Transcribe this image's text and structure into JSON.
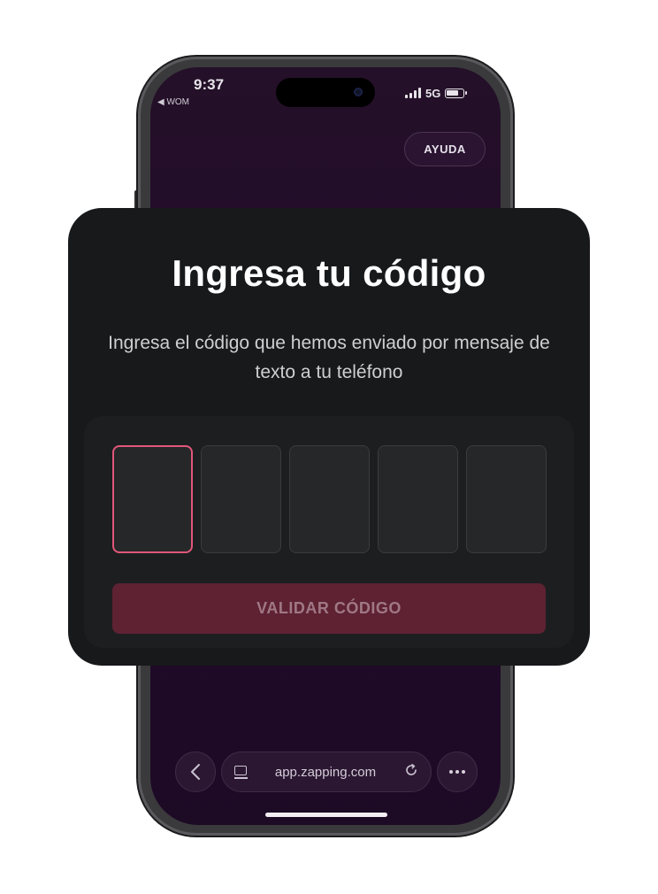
{
  "status_bar": {
    "time": "9:37",
    "back_label": "◀ WOM",
    "network": "5G"
  },
  "header": {
    "help_label": "AYUDA"
  },
  "dialog": {
    "title": "Ingresa tu código",
    "subtitle": "Ingresa el código que hemos enviado por mensaje de texto a tu teléfono",
    "code_length": 5,
    "active_index": 0,
    "validate_label": "VALIDAR CÓDIGO"
  },
  "browser": {
    "url": "app.zapping.com",
    "back_icon": "chevron-left-icon",
    "tabs_icon": "tabs-icon",
    "reload_icon": "reload-icon",
    "more_icon": "more-icon"
  },
  "colors": {
    "accent": "#e0577a",
    "button_disabled": "#5e2233",
    "card_bg": "#18191b",
    "screen_bg": "#220a2c"
  }
}
